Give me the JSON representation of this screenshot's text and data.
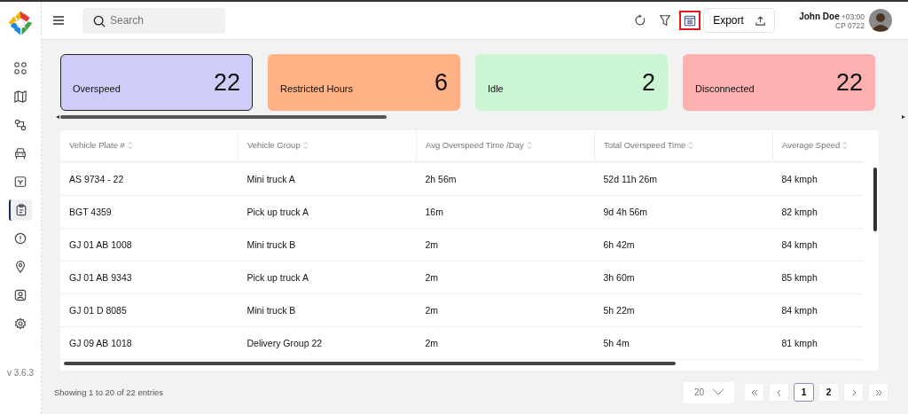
{
  "sidebar": {
    "nav_items": [
      {
        "selected": false
      },
      {
        "selected": false
      },
      {
        "selected": false
      },
      {
        "selected": false
      },
      {
        "selected": false
      },
      {
        "selected": true
      },
      {
        "selected": false
      },
      {
        "selected": false
      },
      {
        "selected": false
      },
      {
        "selected": false
      }
    ],
    "version": "v 3.6.3"
  },
  "header": {
    "search": {
      "placeholder": "Search"
    },
    "toolbar_buttons": [
      {
        "kind": "refresh",
        "highlighted": false
      },
      {
        "kind": "filter",
        "highlighted": false
      },
      {
        "kind": "calendar",
        "highlighted": true
      }
    ],
    "export_button": "Export",
    "user": {
      "name": "John Doe",
      "timezone": "+03:00",
      "code": "CP 0722"
    }
  },
  "cards": [
    {
      "label": "Overspeed",
      "count": "22",
      "color": "#cfcdf8",
      "selected": true
    },
    {
      "label": "Restricted Hours",
      "count": "6",
      "color": "#fdb184",
      "selected": false
    },
    {
      "label": "Idle",
      "count": "2",
      "color": "#ccf6d3",
      "selected": false
    },
    {
      "label": "Disconnected",
      "count": "22",
      "color": "#fdb0b0",
      "selected": false
    }
  ],
  "table": {
    "columns": [
      "Vehicle Plate #",
      "Vehicle Group",
      "Avg Overspeed Time /Day",
      "Total Overspeed Time",
      "Average Speed"
    ],
    "rows": [
      [
        "AS 9734 - 22",
        "Mini truck A",
        "2h 56m",
        "52d 11h 26m",
        "84 kmph"
      ],
      [
        "BGT 4359",
        "Pick up truck A",
        "16m",
        "9d 4h 56m",
        "82 kmph"
      ],
      [
        "GJ 01 AB 1008",
        "Mini truck B",
        "2m",
        "6h 42m",
        "84 kmph"
      ],
      [
        "GJ 01 AB 9343",
        "Pick up truck A",
        "2m",
        "3h 60m",
        "85 kmph"
      ],
      [
        "GJ 01 D 8085",
        "Mini truck B",
        "2m",
        "5h 22m",
        "84 kmph"
      ],
      [
        "GJ 09 AB 1018",
        "Delivery Group 22",
        "2m",
        "5h 4m",
        "81 kmph"
      ]
    ]
  },
  "footer": {
    "summary": "Showing 1 to 20 of 22 entries",
    "page_size": "20",
    "pages": [
      {
        "label": "1",
        "selected": true
      },
      {
        "label": "2",
        "selected": false
      }
    ]
  }
}
